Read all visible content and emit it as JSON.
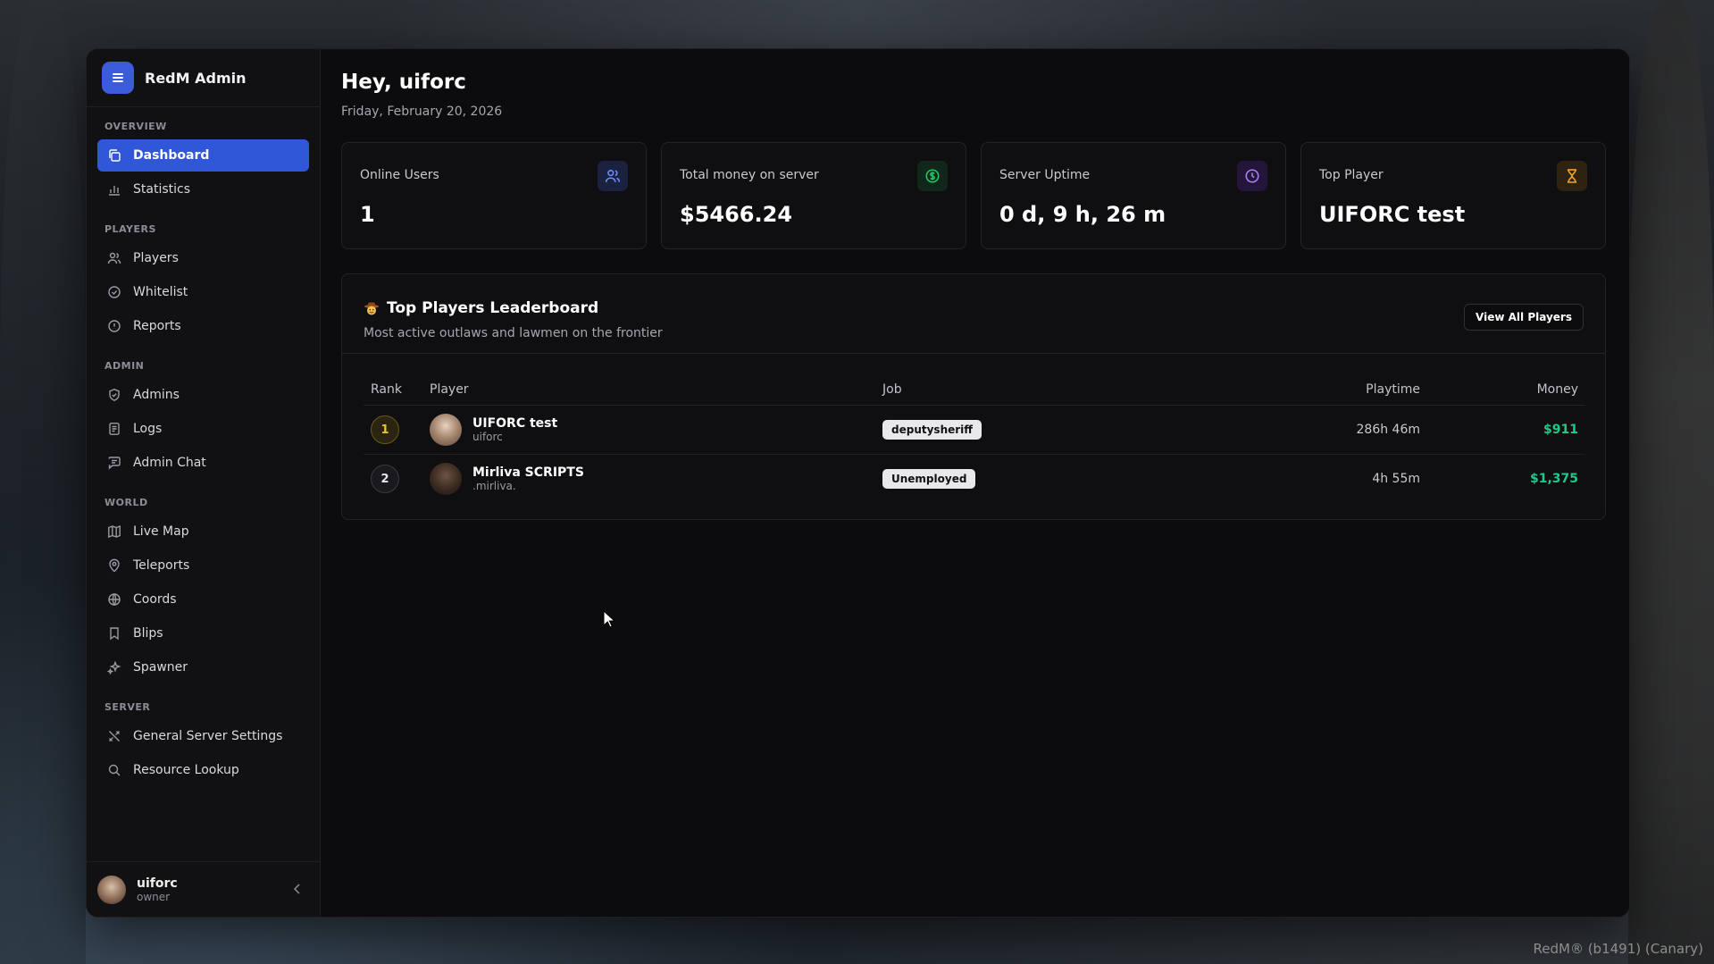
{
  "brand": {
    "title": "RedM Admin"
  },
  "sidebar": {
    "sections": {
      "overview": "OVERVIEW",
      "players": "PLAYERS",
      "admin": "ADMIN",
      "world": "WORLD",
      "server": "SERVER"
    },
    "items": {
      "dashboard": "Dashboard",
      "statistics": "Statistics",
      "players": "Players",
      "whitelist": "Whitelist",
      "reports": "Reports",
      "admins": "Admins",
      "logs": "Logs",
      "admin_chat": "Admin Chat",
      "live_map": "Live Map",
      "teleports": "Teleports",
      "coords": "Coords",
      "blips": "Blips",
      "spawner": "Spawner",
      "general_settings": "General Server Settings",
      "resource_lookup": "Resource Lookup"
    },
    "user": {
      "name": "uiforc",
      "role": "owner"
    }
  },
  "header": {
    "greeting": "Hey, uiforc",
    "date": "Friday, February 20, 2026"
  },
  "cards": [
    {
      "label": "Online Users",
      "value": "1",
      "icon": "users-icon",
      "color": "#4c6fff"
    },
    {
      "label": "Total money on server",
      "value": "$5466.24",
      "icon": "dollar-icon",
      "color": "#22c55e"
    },
    {
      "label": "Server Uptime",
      "value": "0 d, 9 h, 26 m",
      "icon": "clock-icon",
      "color": "#a855f7"
    },
    {
      "label": "Top Player",
      "value": "UIFORC test",
      "icon": "hourglass-icon",
      "color": "#f59e0b"
    }
  ],
  "leaderboard": {
    "title": "Top Players Leaderboard",
    "subtitle": "Most active outlaws and lawmen on the frontier",
    "view_all": "View All Players",
    "columns": {
      "rank": "Rank",
      "player": "Player",
      "job": "Job",
      "playtime": "Playtime",
      "money": "Money"
    },
    "rows": [
      {
        "rank": "1",
        "name": "UIFORC test",
        "username": "uiforc",
        "job": "deputysheriff",
        "playtime": "286h 46m",
        "money": "$911"
      },
      {
        "rank": "2",
        "name": "Mirliva SCRIPTS",
        "username": ".mirliva.",
        "job": "Unemployed",
        "playtime": "4h 55m",
        "money": "$1,375"
      }
    ]
  },
  "footer": {
    "version": "RedM® (b1491) (Canary)"
  }
}
